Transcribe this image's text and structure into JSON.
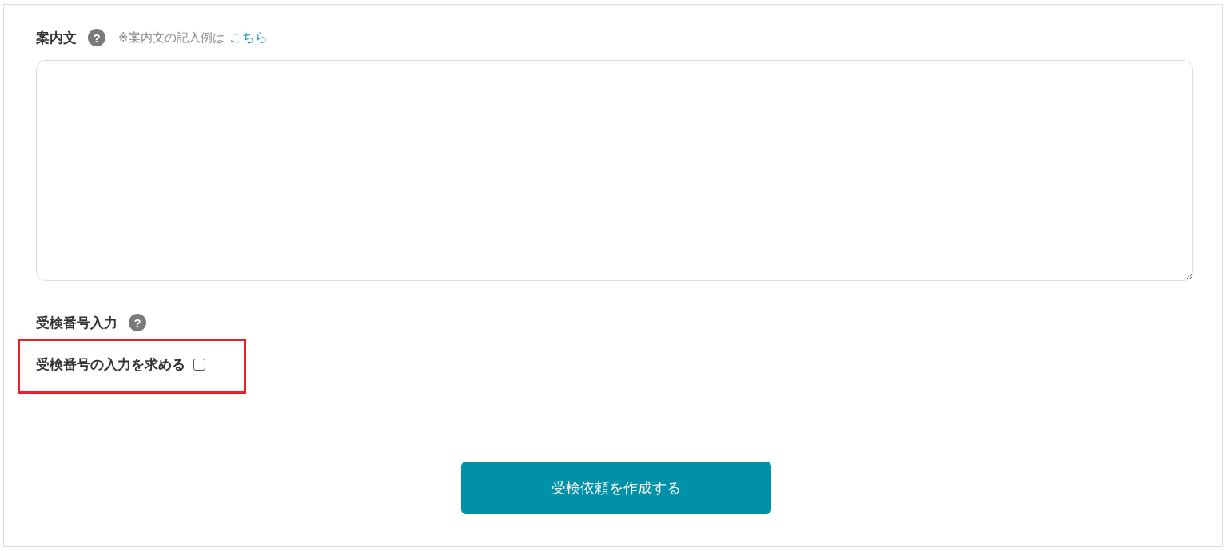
{
  "guide_text": {
    "label": "案内文",
    "help_icon": "?",
    "note": "※案内文の記入例は",
    "link": "こちら"
  },
  "exam_number": {
    "label": "受検番号入力",
    "help_icon": "?",
    "option": {
      "label": "受検番号の入力を求める",
      "checked": false,
      "highlighted": true
    }
  },
  "submit_button": "受検依頼を作成する"
}
